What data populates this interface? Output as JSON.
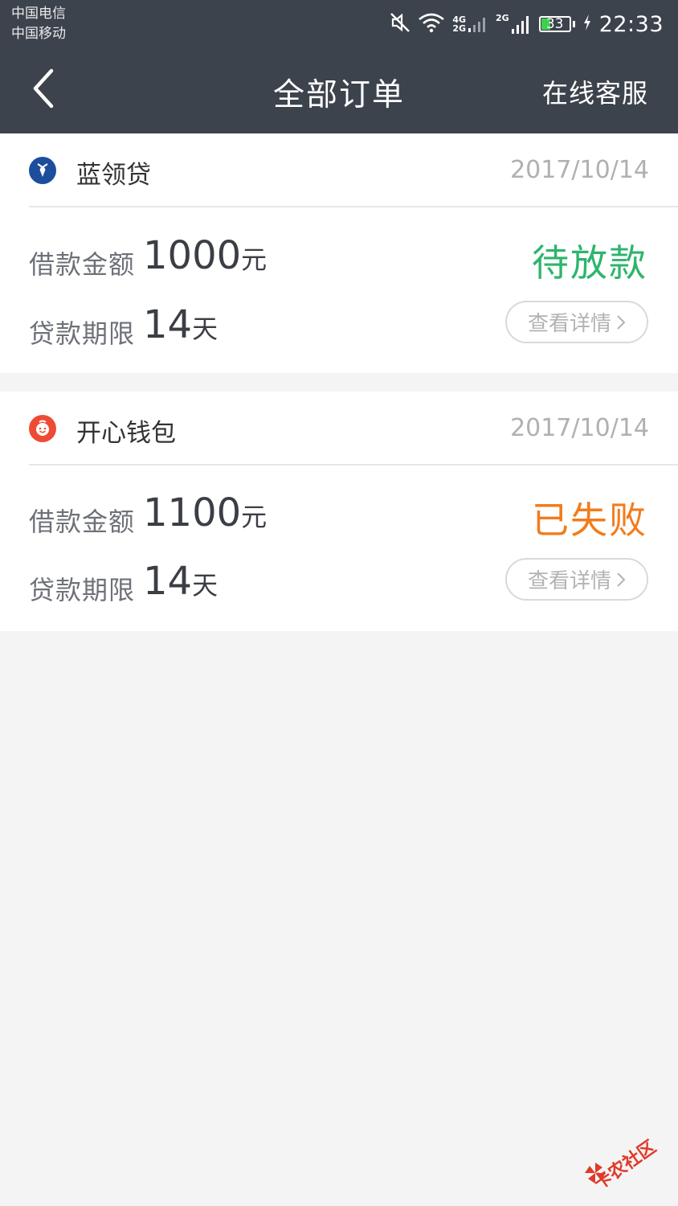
{
  "status_bar": {
    "carrier_1": "中国电信",
    "carrier_2": "中国移动",
    "net_1_top": "4G",
    "net_1_bottom": "2G",
    "net_2": "2G",
    "battery_level": 33,
    "battery_label": "33",
    "time": "22:33",
    "icons": [
      "mute-icon",
      "wifi-icon",
      "signal-icon",
      "signal-icon",
      "battery-icon",
      "charging-icon"
    ],
    "colors": {
      "bar": "#3d434d",
      "battery_fill": "#3fd04f"
    }
  },
  "nav": {
    "back_icon": "chevron-left-icon",
    "title": "全部订单",
    "service_label": "在线客服"
  },
  "orders": [
    {
      "lender": "蓝领贷",
      "logo_icon": "tie-icon",
      "logo_color": "#1c4e9c",
      "date": "2017/10/14",
      "amount_label": "借款金额",
      "amount_value": "1000",
      "amount_unit": "元",
      "term_label": "贷款期限",
      "term_value": "14",
      "term_unit": "天",
      "status": "待放款",
      "status_color": "#2db56d",
      "detail_label": "查看详情"
    },
    {
      "lender": "开心钱包",
      "logo_icon": "smiley-face-icon",
      "logo_color": "#ee4b35",
      "date": "2017/10/14",
      "amount_label": "借款金额",
      "amount_value": "1100",
      "amount_unit": "元",
      "term_label": "贷款期限",
      "term_value": "14",
      "term_unit": "天",
      "status": "已失败",
      "status_color": "#f27c1c",
      "detail_label": "查看详情"
    }
  ],
  "watermark": {
    "text": "卡农社区",
    "icon": "pinwheel-icon"
  }
}
